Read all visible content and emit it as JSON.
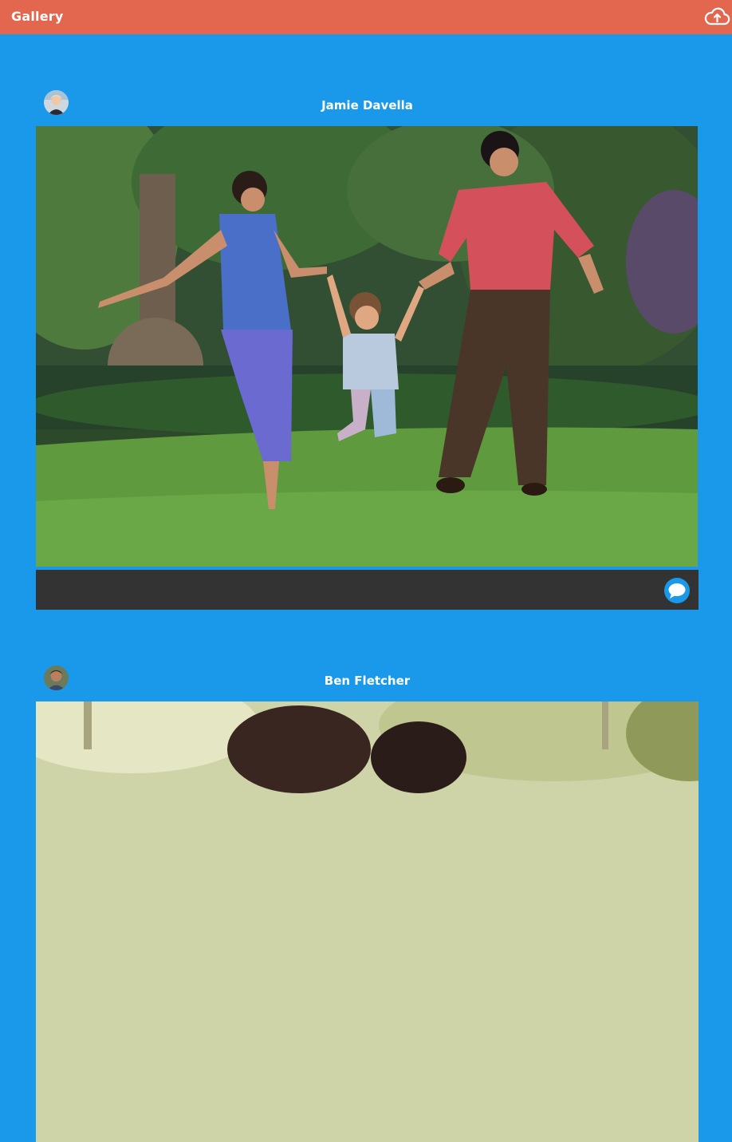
{
  "app": {
    "title": "Gallery",
    "accent_color": "#e3674f",
    "background_color": "#1a99ea",
    "upload_icon": "cloud-upload-icon"
  },
  "posts": [
    {
      "author": "Jamie Davella",
      "avatar": "avatar-jamie",
      "photo_description": "family-running-in-park",
      "comment_icon": "speech-bubble-icon"
    },
    {
      "author": "Ben Fletcher",
      "avatar": "avatar-ben",
      "photo_description": "outdoor-portrait",
      "comment_icon": "speech-bubble-icon"
    }
  ]
}
